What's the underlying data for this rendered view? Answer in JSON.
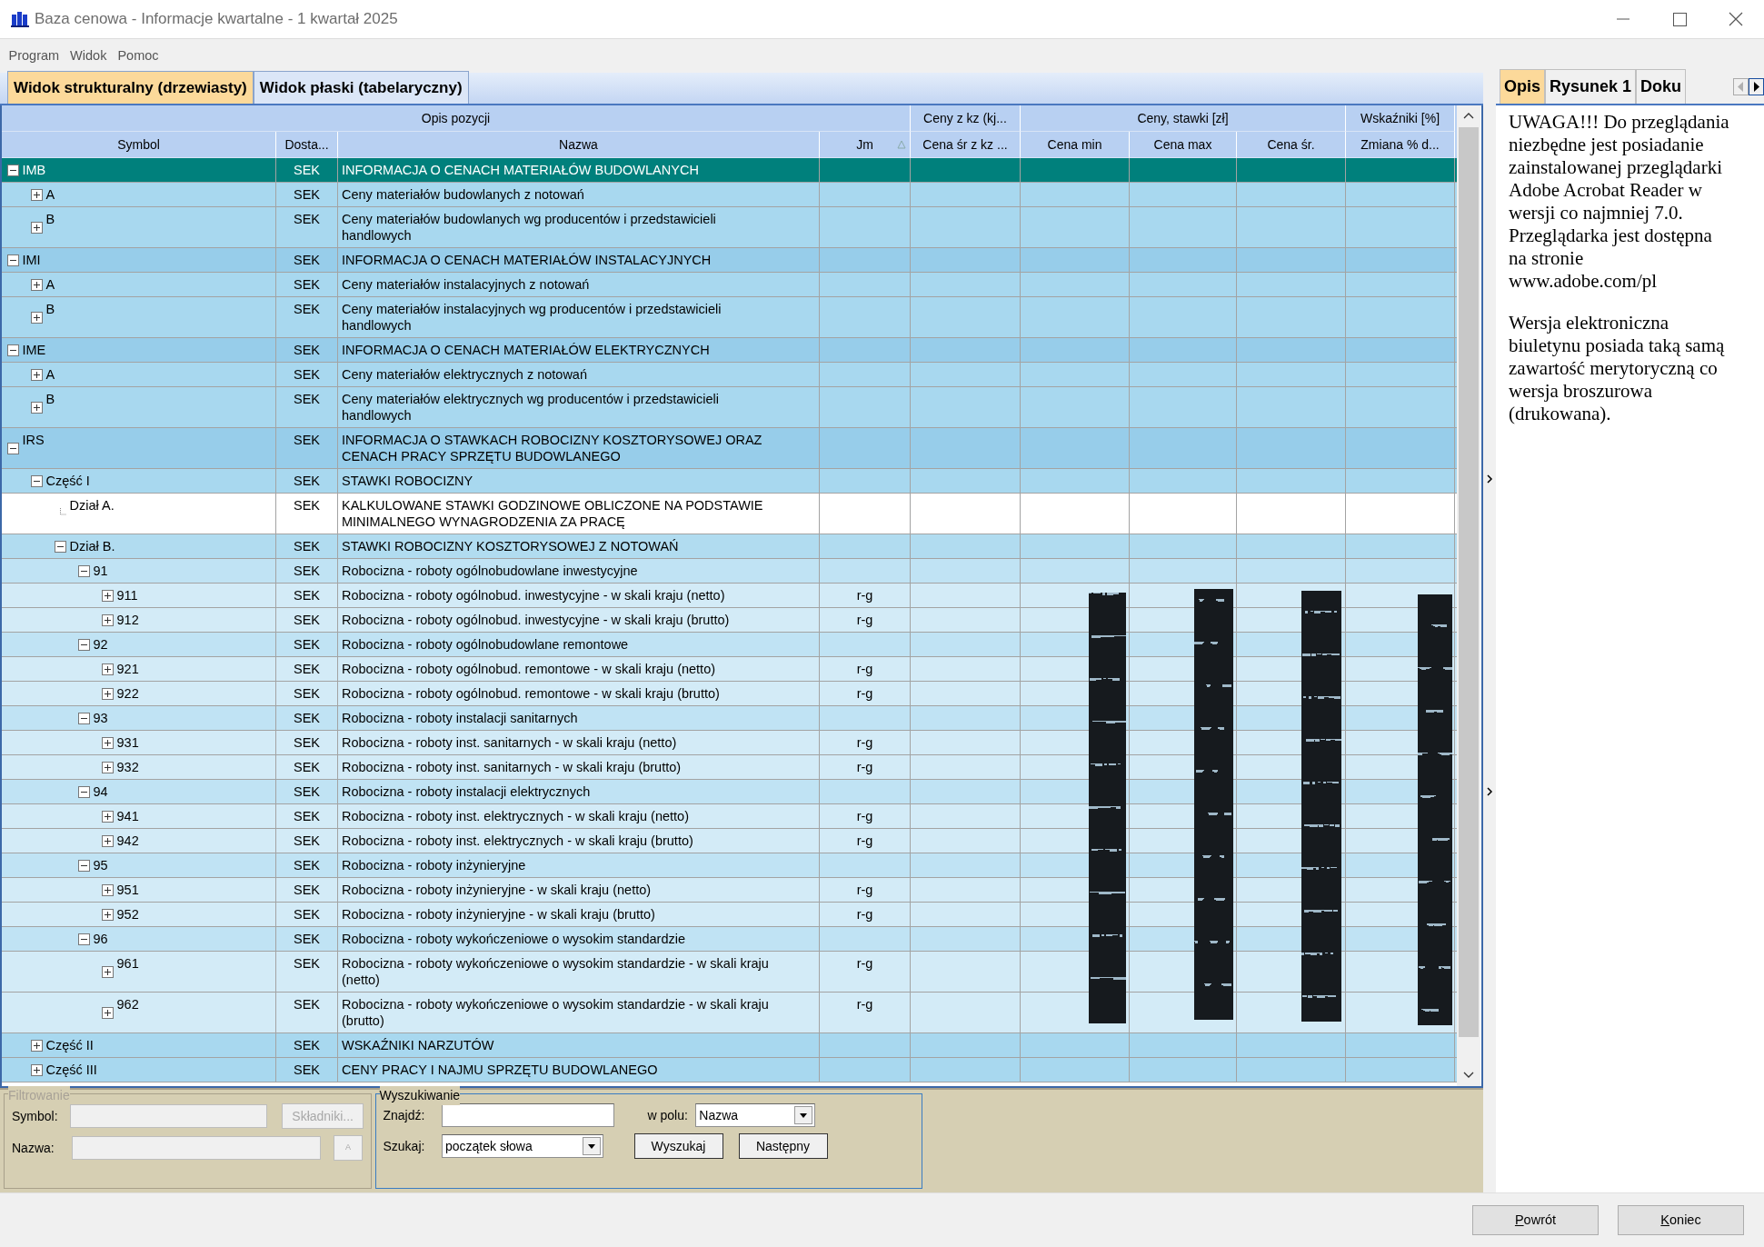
{
  "window": {
    "title": "Baza cenowa - Informacje kwartalne - 1 kwartał 2025"
  },
  "menu": [
    "Program",
    "Widok",
    "Pomoc"
  ],
  "view_tabs": [
    {
      "label": "Widok strukturalny (drzewiasty)",
      "selected": true
    },
    {
      "label": "Widok płaski (tabelaryczny)",
      "selected": false
    }
  ],
  "grid": {
    "column_groups": [
      {
        "label": "Opis pozycji",
        "columns": [
          {
            "label": "Symbol",
            "sorted": false
          },
          {
            "label": "Dosta...",
            "sorted": false
          },
          {
            "label": "Nazwa",
            "sorted": false
          },
          {
            "label": "Jm",
            "sorted": true
          }
        ]
      },
      {
        "label": "Ceny z kz (kj...",
        "columns": [
          {
            "label": "Cena śr z kz ...",
            "sorted": false
          }
        ]
      },
      {
        "label": "Ceny, stawki [zł]",
        "columns": [
          {
            "label": "Cena min",
            "sorted": false
          },
          {
            "label": "Cena max",
            "sorted": false
          },
          {
            "label": "Cena śr.",
            "sorted": false
          }
        ]
      },
      {
        "label": "Wskaźniki [%]",
        "columns": [
          {
            "label": "Zmiana % d...",
            "sorted": false
          }
        ]
      }
    ],
    "rows": [
      {
        "symbol": "IMB",
        "supplier": "SEK",
        "name": "INFORMACJA O CENACH MATERIAŁÓW BUDOWLANYCH",
        "kind": "node",
        "expanded": true,
        "selected": true,
        "children": [
          {
            "symbol": "A",
            "supplier": "SEK",
            "name": "Ceny materiałów budowlanych z notowań",
            "kind": "node",
            "expanded": false,
            "selected": false
          },
          {
            "symbol": "B",
            "supplier": "SEK",
            "name": "Ceny materiałów budowlanych wg producentów i przedstawicieli\nhandlowych",
            "kind": "node",
            "expanded": false,
            "selected": false
          }
        ]
      },
      {
        "symbol": "IMI",
        "supplier": "SEK",
        "name": "INFORMACJA O CENACH MATERIAŁÓW INSTALACYJNYCH",
        "kind": "node",
        "expanded": true,
        "selected": false,
        "children": [
          {
            "symbol": "A",
            "supplier": "SEK",
            "name": "Ceny materiałów instalacyjnych z notowań",
            "kind": "node",
            "expanded": false,
            "selected": false
          },
          {
            "symbol": "B",
            "supplier": "SEK",
            "name": "Ceny materiałów instalacyjnych wg producentów i przedstawicieli\nhandlowych",
            "kind": "node",
            "expanded": false,
            "selected": false
          }
        ]
      },
      {
        "symbol": "IME",
        "supplier": "SEK",
        "name": "INFORMACJA O CENACH MATERIAŁÓW ELEKTRYCZNYCH",
        "kind": "node",
        "expanded": true,
        "selected": false,
        "children": [
          {
            "symbol": "A",
            "supplier": "SEK",
            "name": "Ceny materiałów elektrycznych z notowań",
            "kind": "node",
            "expanded": false,
            "selected": false
          },
          {
            "symbol": "B",
            "supplier": "SEK",
            "name": "Ceny materiałów elektrycznych wg producentów i przedstawicieli\nhandlowych",
            "kind": "node",
            "expanded": false,
            "selected": false
          }
        ]
      },
      {
        "symbol": "IRS",
        "supplier": "SEK",
        "name": "INFORMACJA O STAWKACH ROBOCIZNY KOSZTORYSOWEJ ORAZ\nCENACH PRACY SPRZĘTU BUDOWLANEGO",
        "kind": "node",
        "expanded": true,
        "selected": false,
        "children": [
          {
            "symbol": "Część I",
            "supplier": "SEK",
            "name": "STAWKI ROBOCIZNY",
            "kind": "node",
            "expanded": true,
            "selected": false,
            "children": [
              {
                "symbol": "Dział A.",
                "supplier": "SEK",
                "name": "KALKULOWANE STAWKI GODZINOWE OBLICZONE NA PODSTAWIE\nMINIMALNEGO WYNAGRODZENIA ZA PRACĘ",
                "kind": "leaf",
                "selected": false
              },
              {
                "symbol": "Dział B.",
                "supplier": "SEK",
                "name": "STAWKI ROBOCIZNY KOSZTORYSOWEJ Z NOTOWAŃ",
                "kind": "node",
                "expanded": true,
                "selected": false,
                "children": [
                  {
                    "symbol": "91",
                    "supplier": "SEK",
                    "name": "Robocizna - roboty ogólnobudowlane inwestycyjne",
                    "kind": "node",
                    "expanded": true,
                    "selected": false,
                    "children": [
                      {
                        "symbol": "911",
                        "supplier": "SEK",
                        "name": "Robocizna - roboty ogólnobud. inwestycyjne - w skali kraju (netto)",
                        "unit": "r-g",
                        "kind": "node",
                        "expanded": false,
                        "selected": false
                      },
                      {
                        "symbol": "912",
                        "supplier": "SEK",
                        "name": "Robocizna - roboty ogólnobud. inwestycyjne - w skali kraju (brutto)",
                        "unit": "r-g",
                        "kind": "node",
                        "expanded": false,
                        "selected": false
                      }
                    ]
                  },
                  {
                    "symbol": "92",
                    "supplier": "SEK",
                    "name": "Robocizna - roboty ogólnobudowlane remontowe",
                    "kind": "node",
                    "expanded": true,
                    "selected": false,
                    "children": [
                      {
                        "symbol": "921",
                        "supplier": "SEK",
                        "name": "Robocizna - roboty ogólnobud. remontowe - w skali kraju (netto)",
                        "unit": "r-g",
                        "kind": "node",
                        "expanded": false,
                        "selected": false
                      },
                      {
                        "symbol": "922",
                        "supplier": "SEK",
                        "name": "Robocizna - roboty ogólnobud. remontowe - w skali kraju (brutto)",
                        "unit": "r-g",
                        "kind": "node",
                        "expanded": false,
                        "selected": false
                      }
                    ]
                  },
                  {
                    "symbol": "93",
                    "supplier": "SEK",
                    "name": "Robocizna - roboty instalacji sanitarnych",
                    "kind": "node",
                    "expanded": true,
                    "selected": false,
                    "children": [
                      {
                        "symbol": "931",
                        "supplier": "SEK",
                        "name": "Robocizna - roboty inst. sanitarnych - w skali kraju (netto)",
                        "unit": "r-g",
                        "kind": "node",
                        "expanded": false,
                        "selected": false
                      },
                      {
                        "symbol": "932",
                        "supplier": "SEK",
                        "name": "Robocizna - roboty inst. sanitarnych - w skali kraju (brutto)",
                        "unit": "r-g",
                        "kind": "node",
                        "expanded": false,
                        "selected": false
                      }
                    ]
                  },
                  {
                    "symbol": "94",
                    "supplier": "SEK",
                    "name": "Robocizna - roboty instalacji elektrycznych",
                    "kind": "node",
                    "expanded": true,
                    "selected": false,
                    "children": [
                      {
                        "symbol": "941",
                        "supplier": "SEK",
                        "name": "Robocizna - roboty inst. elektrycznych - w skali kraju (netto)",
                        "unit": "r-g",
                        "kind": "node",
                        "expanded": false,
                        "selected": false
                      },
                      {
                        "symbol": "942",
                        "supplier": "SEK",
                        "name": "Robocizna - roboty inst. elektrycznych - w skali kraju (brutto)",
                        "unit": "r-g",
                        "kind": "node",
                        "expanded": false,
                        "selected": false
                      }
                    ]
                  },
                  {
                    "symbol": "95",
                    "supplier": "SEK",
                    "name": "Robocizna - roboty inżynieryjne",
                    "kind": "node",
                    "expanded": true,
                    "selected": false,
                    "children": [
                      {
                        "symbol": "951",
                        "supplier": "SEK",
                        "name": "Robocizna - roboty inżynieryjne - w skali kraju (netto)",
                        "unit": "r-g",
                        "kind": "node",
                        "expanded": false,
                        "selected": false
                      },
                      {
                        "symbol": "952",
                        "supplier": "SEK",
                        "name": "Robocizna - roboty inżynieryjne - w skali kraju (brutto)",
                        "unit": "r-g",
                        "kind": "node",
                        "expanded": false,
                        "selected": false
                      }
                    ]
                  },
                  {
                    "symbol": "96",
                    "supplier": "SEK",
                    "name": "Robocizna - roboty wykończeniowe o wysokim standardzie",
                    "kind": "node",
                    "expanded": true,
                    "selected": false,
                    "children": [
                      {
                        "symbol": "961",
                        "supplier": "SEK",
                        "name": "Robocizna - roboty wykończeniowe o wysokim standardzie - w skali kraju\n(netto)",
                        "unit": "r-g",
                        "kind": "node",
                        "expanded": false,
                        "selected": false
                      },
                      {
                        "symbol": "962",
                        "supplier": "SEK",
                        "name": "Robocizna - roboty wykończeniowe o wysokim standardzie - w skali kraju\n(brutto)",
                        "unit": "r-g",
                        "kind": "node",
                        "expanded": false,
                        "selected": false
                      }
                    ]
                  }
                ]
              }
            ]
          },
          {
            "symbol": "Część II",
            "supplier": "SEK",
            "name": "WSKAŹNIKI NARZUTÓW",
            "kind": "node",
            "expanded": false,
            "selected": false
          },
          {
            "symbol": "Część III",
            "supplier": "SEK",
            "name": "CENY PRACY I NAJMU SPRZĘTU BUDOWLANEGO",
            "kind": "node",
            "expanded": false,
            "selected": false
          }
        ]
      }
    ]
  },
  "filter": {
    "legend": "Filtrowanie",
    "disabled": true,
    "rows": [
      {
        "label": "Symbol:",
        "button": "Składniki..."
      },
      {
        "label": "Nazwa:",
        "button": "A"
      }
    ]
  },
  "search": {
    "legend": "Wyszukiwanie",
    "disabled": false,
    "find_label": "Znajdź:",
    "field_label": "w polu:",
    "field_value": "Nazwa",
    "mode_label": "Szukaj:",
    "mode_value": "początek słowa",
    "buttons": [
      "Wyszukaj",
      "Następny"
    ]
  },
  "side_tabs": [
    {
      "label": "Opis",
      "selected": true
    },
    {
      "label": "Rysunek 1",
      "selected": false
    },
    {
      "label": "Doku",
      "selected": false
    }
  ],
  "side_tab_scroll": {
    "back_disabled": true,
    "forward_disabled": false
  },
  "description": {
    "paragraphs": [
      "UWAGA!!! Do przeglądania\nniezbędne jest posiadanie\nzainstalowanej przeglądarki\nAdobe Acrobat Reader w\nwersji co najmniej 7.0.\nPrzeglądarka jest dostępna\nna stronie\nwww.adobe.com/pl",
      "Wersja elektroniczna\nbiuletynu posiada taką samą\nzawartość merytoryczną co\nwersja broszurowa\n(drukowana)."
    ]
  },
  "footer_buttons": [
    "Powrót",
    "Koniec"
  ]
}
